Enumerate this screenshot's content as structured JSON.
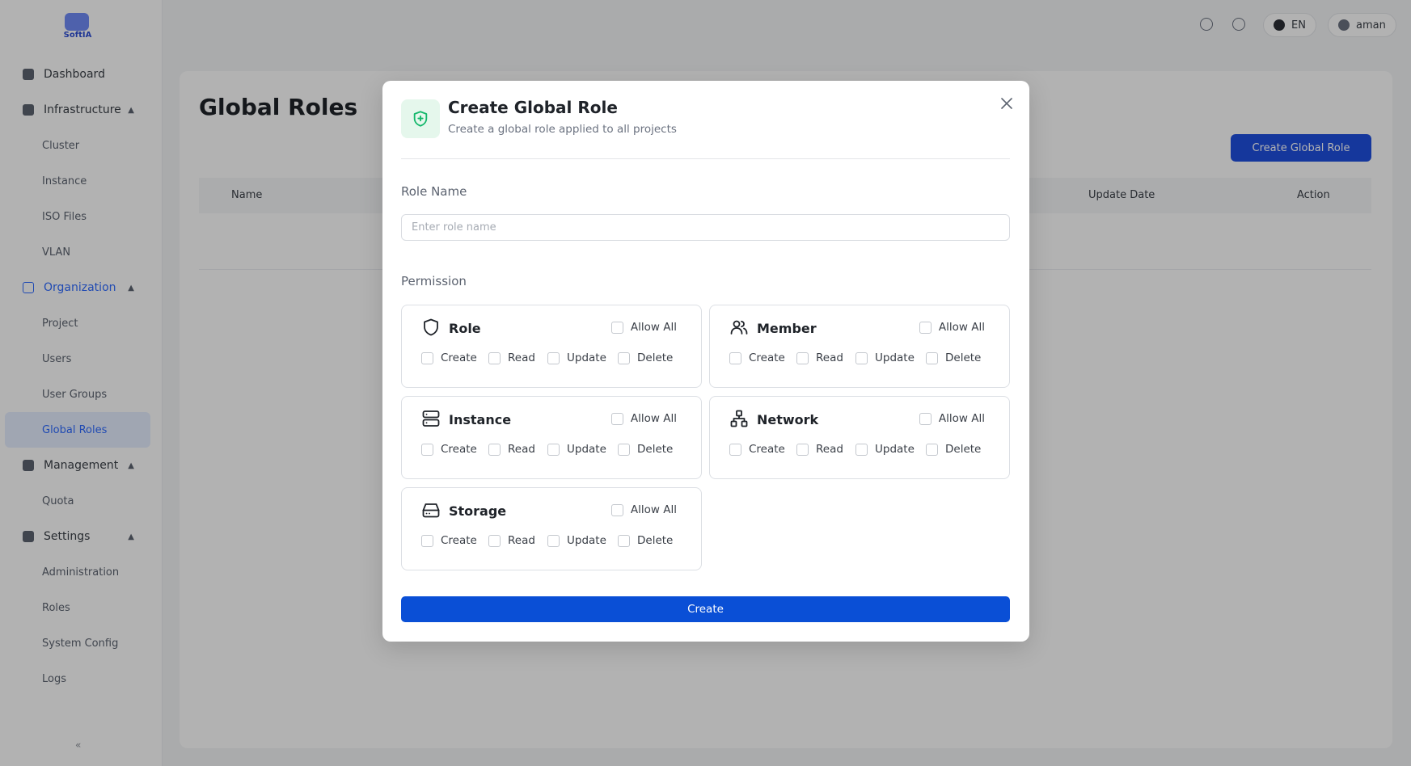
{
  "sidebar": {
    "logo_text": "SoftIA",
    "items": [
      {
        "label": "Dashboard"
      },
      {
        "label": "Infrastructure",
        "children": [
          "Cluster",
          "Instance",
          "ISO Files",
          "VLAN"
        ]
      },
      {
        "label": "Organization",
        "children": [
          "Project",
          "Users",
          "User Groups",
          "Global Roles"
        ]
      },
      {
        "label": "Management",
        "children": [
          "Quota"
        ]
      },
      {
        "label": "Settings",
        "children": [
          "Administration",
          "Roles",
          "System Config",
          "Logs"
        ]
      }
    ],
    "collapse_label": "«"
  },
  "topbar": {
    "lang_label": "EN",
    "user_label": "aman"
  },
  "page": {
    "title": "Global Roles",
    "create_button": "Create Global Role",
    "columns": [
      "Name",
      "Update Date",
      "Action"
    ]
  },
  "modal": {
    "title": "Create Global Role",
    "subtitle": "Create a global role applied to all projects",
    "role_name_label": "Role Name",
    "role_name_placeholder": "Enter role name",
    "role_name_value": "",
    "permission_label": "Permission",
    "allow_all_label": "Allow All",
    "ops": [
      "Create",
      "Read",
      "Update",
      "Delete"
    ],
    "permissions": [
      {
        "name": "Role",
        "icon": "shield-icon"
      },
      {
        "name": "Member",
        "icon": "users-icon"
      },
      {
        "name": "Instance",
        "icon": "server-icon"
      },
      {
        "name": "Network",
        "icon": "network-icon"
      },
      {
        "name": "Storage",
        "icon": "hard-drive-icon"
      }
    ],
    "submit_label": "Create",
    "colors": {
      "primary": "#0a4fd6",
      "accent_green": "#12b76a"
    }
  }
}
